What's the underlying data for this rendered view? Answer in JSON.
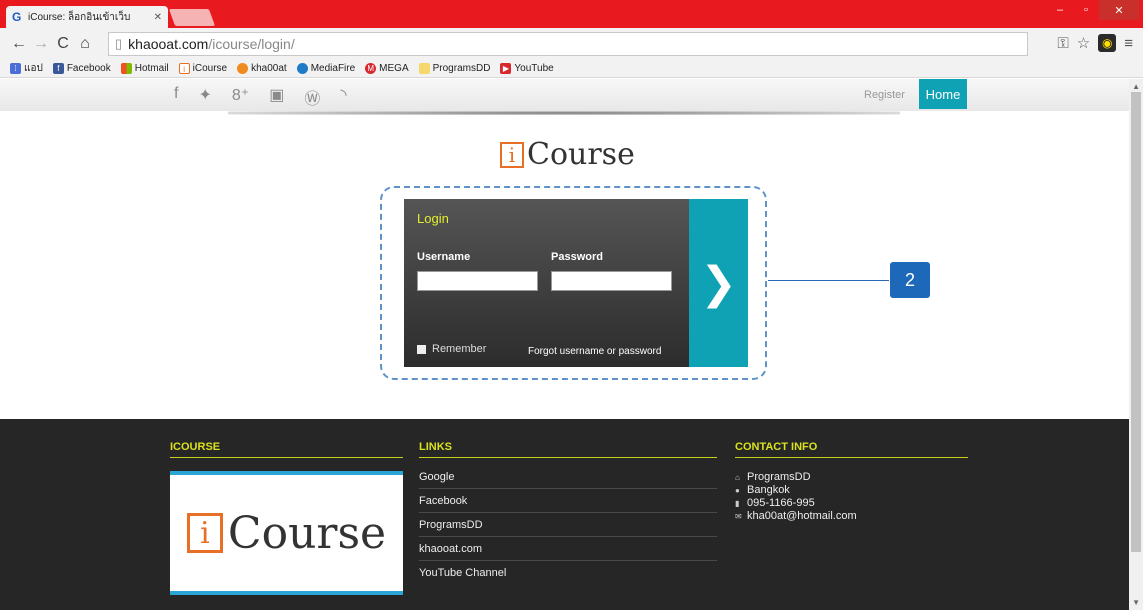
{
  "browser": {
    "tab_title": "iCourse: ล็อกอินเข้าเว็บ",
    "tab_favicon": "G",
    "url_domain": "khaooat.com",
    "url_path": "/icourse/login/"
  },
  "bookmarks": [
    {
      "label": "แอป",
      "icon": "apps-grid-icon",
      "color": "#4a6fd8"
    },
    {
      "label": "Facebook",
      "icon": "facebook-icon",
      "color": "#3b5998"
    },
    {
      "label": "Hotmail",
      "icon": "windows-icon",
      "color": "#f25022"
    },
    {
      "label": "iCourse",
      "icon": "icourse-icon",
      "color": "#e86f28"
    },
    {
      "label": "kha00at",
      "icon": "kha00at-icon",
      "color": "#f08c1e"
    },
    {
      "label": "MediaFire",
      "icon": "mediafire-icon",
      "color": "#1e7bc8"
    },
    {
      "label": "MEGA",
      "icon": "mega-icon",
      "color": "#d9272e"
    },
    {
      "label": "ProgramsDD",
      "icon": "programsdd-icon",
      "color": "#f5d76e"
    },
    {
      "label": "YouTube",
      "icon": "youtube-icon",
      "color": "#d9272e"
    }
  ],
  "site": {
    "register_label": "Register",
    "home_label": "Home",
    "logo_i": "i",
    "logo_text": "Course"
  },
  "login": {
    "title": "Login",
    "username_label": "Username",
    "password_label": "Password",
    "remember_label": "Remember",
    "forgot_label": "Forgot username or password",
    "submit_glyph": "❯"
  },
  "callout": {
    "number": "2"
  },
  "footer": {
    "icourse_heading": "ICOURSE",
    "links_heading": "LINKS",
    "contact_heading": "CONTACT INFO",
    "links": [
      "Google",
      "Facebook",
      "ProgramsDD",
      "khaooat.com",
      "YouTube Channel"
    ],
    "contact": [
      {
        "icon": "home-icon",
        "glyph": "⌂",
        "text": "ProgramsDD"
      },
      {
        "icon": "location-icon",
        "glyph": "●",
        "text": "Bangkok"
      },
      {
        "icon": "phone-icon",
        "glyph": "▮",
        "text": "095-1166-995"
      },
      {
        "icon": "mail-icon",
        "glyph": "✉",
        "text": "kha00at@hotmail.com"
      }
    ]
  },
  "colors": {
    "titlebar": "#e8191f",
    "accent_teal": "#0fa2b5",
    "footer_heading": "#d9e21d",
    "logo_orange": "#e86f28",
    "callout_blue": "#1e68b9"
  }
}
